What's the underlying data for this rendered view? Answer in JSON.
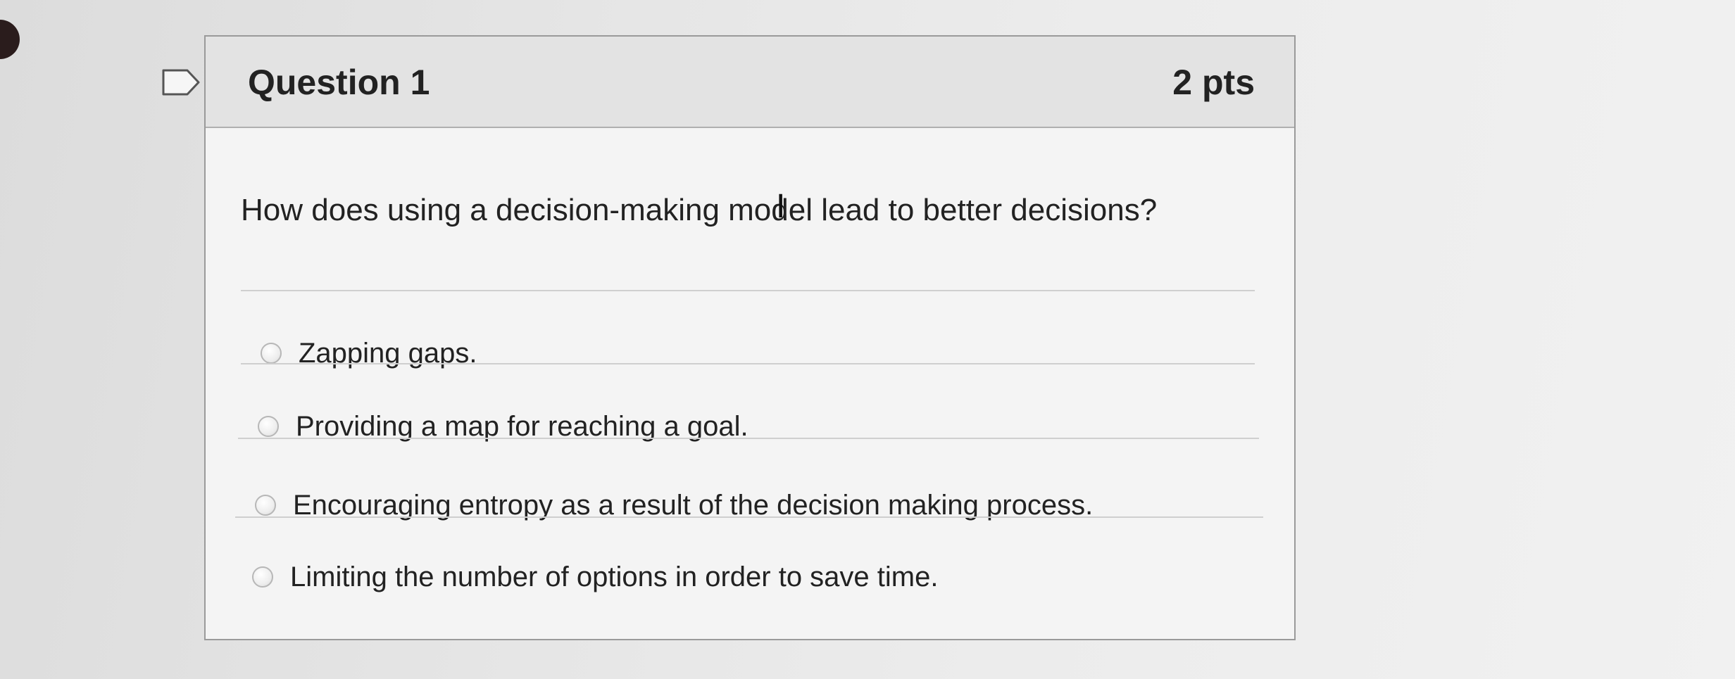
{
  "question": {
    "title": "Question 1",
    "points": "2 pts",
    "text": "How does using a decision-making model lead to better decisions?"
  },
  "answers": [
    {
      "label": "Zapping gaps.",
      "selected": false
    },
    {
      "label": "Providing a map for reaching a goal.",
      "selected": false
    },
    {
      "label": "Encouraging entropy as a result of the decision making process.",
      "selected": false
    },
    {
      "label": "Limiting the number of options in order to save time.",
      "selected": false
    }
  ],
  "icons": {
    "flag": "flag-question-icon",
    "cursor": "text-cursor-icon"
  }
}
